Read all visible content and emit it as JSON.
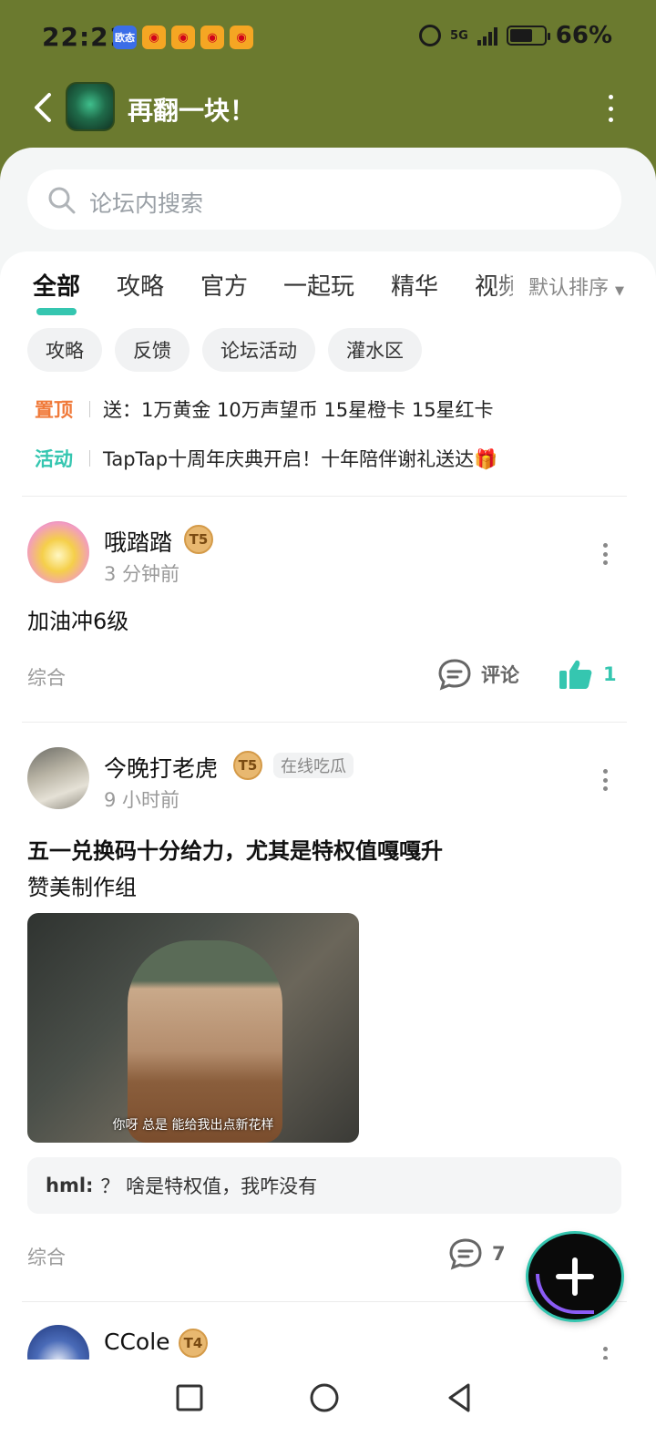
{
  "status_bar": {
    "time": "22:21",
    "notif_news_label": "欧态",
    "network": "5G",
    "battery_percent": "66%",
    "battery_level": 0.66
  },
  "app_bar": {
    "title": "再翻一块！"
  },
  "search": {
    "placeholder": "论坛内搜索"
  },
  "tabs": [
    {
      "label": "全部",
      "active": true
    },
    {
      "label": "攻略"
    },
    {
      "label": "官方"
    },
    {
      "label": "一起玩"
    },
    {
      "label": "精华"
    },
    {
      "label": "视频"
    }
  ],
  "sort_label": "默认排序",
  "chips": [
    "攻略",
    "反馈",
    "论坛活动",
    "灌水区"
  ],
  "notices": [
    {
      "tag": "置顶",
      "text": "送：1万黄金 10万声望币 15星橙卡 15星红卡"
    },
    {
      "tag": "活动",
      "text": "TapTap十周年庆典开启！十年陪伴谢礼送达🎁"
    }
  ],
  "posts": [
    {
      "username": "哦踏踏",
      "level": "5",
      "time_ago": "3 分钟前",
      "body": "加油冲6级",
      "category": "综合",
      "comment_label": "评论",
      "likes": "1"
    },
    {
      "username": "今晚打老虎",
      "level": "5",
      "badge": "在线吃瓜",
      "time_ago": "9 小时前",
      "title": "五一兑换码十分给力，尤其是特权值嘎嘎升",
      "body": "赞美制作组",
      "image_caption": "你呀 总是 能给我出点新花样",
      "reply_user": "hml:",
      "reply_text": "？ 啥是特权值，我咋没有",
      "category": "综合",
      "comments": "7"
    },
    {
      "username": "CCole",
      "level": "4"
    }
  ],
  "colors": {
    "header_bg": "#6b7a2f",
    "accent": "#35c6b0",
    "pin_tag": "#f07a3a"
  }
}
